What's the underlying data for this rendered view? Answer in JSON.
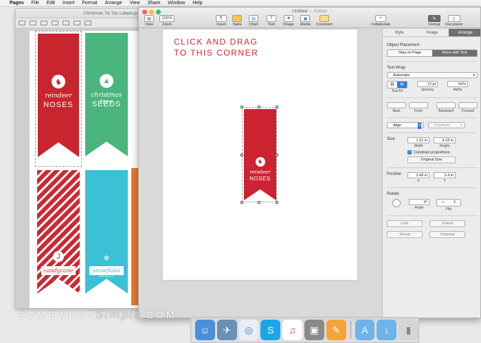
{
  "menubar": {
    "items": [
      "Pages",
      "File",
      "Edit",
      "Insert",
      "Format",
      "Arrange",
      "View",
      "Share",
      "Window",
      "Help"
    ]
  },
  "back_window": {
    "title": "Christmas Tic Tac Labels.pdf",
    "labels": [
      {
        "color": "#c9252e",
        "text": "reindeer",
        "big": "NOSES"
      },
      {
        "color": "#4ab57d",
        "text": "christmas tree",
        "big": "SEEDS"
      },
      {
        "color": "#cc2a33",
        "text": "candycane",
        "big": "SEEDS",
        "plaque": true
      },
      {
        "color": "#3bc1d6",
        "text": "snowflake",
        "big": "SEEDS",
        "plaque": true
      }
    ]
  },
  "front_window": {
    "title": "Untitled",
    "edited": "— Edited",
    "toolbar": {
      "view": "View",
      "zoom_value": "100%",
      "zoom": "Zoom",
      "insert": "Insert",
      "table": "Table",
      "chart": "Chart",
      "text": "Text",
      "shape": "Shape",
      "media": "Media",
      "comment": "Comment",
      "collaborate": "Collaborate",
      "format": "Format",
      "document": "Document"
    },
    "instruction_line1": "CLICK AND DRAG",
    "instruction_line2": "TO THIS CORNER",
    "selected_label": {
      "text": "reindeer",
      "big": "NOSES"
    }
  },
  "inspector": {
    "tabs": [
      "Style",
      "Image",
      "Arrange"
    ],
    "active_tab": "Arrange",
    "object_placement": "Object Placement",
    "stay_on_page": "Stay on Page",
    "move_with_text": "Move with Text",
    "text_wrap": "Text Wrap",
    "text_wrap_value": "Automatic",
    "text_fit": "Text Fit",
    "spacing_value": "12 pt",
    "spacing": "Spacing",
    "alpha_value": "50%",
    "alpha": "Alpha",
    "back": "Back",
    "front": "Front",
    "backward": "Backward",
    "forward": "Forward",
    "align": "Align",
    "distribute": "Distribute",
    "size": "Size",
    "width_value": "1.51 in",
    "width": "Width",
    "height_value": "4.18 in",
    "height": "Height",
    "constrain": "Constrain proportions",
    "original_size": "Original Size",
    "position": "Position",
    "x_value": "3.49 in",
    "x": "X",
    "y_value": "3.4 in",
    "y": "Y",
    "rotate": "Rotate",
    "angle_value": "0°",
    "angle": "Angle",
    "flip": "Flip",
    "lock": "Lock",
    "unlock": "Unlock",
    "group": "Group",
    "ungroup": "Ungroup"
  },
  "watermark": {
    "part1": "SOMEWHAT",
    "part2": "Simple",
    "part3": ".COM"
  }
}
